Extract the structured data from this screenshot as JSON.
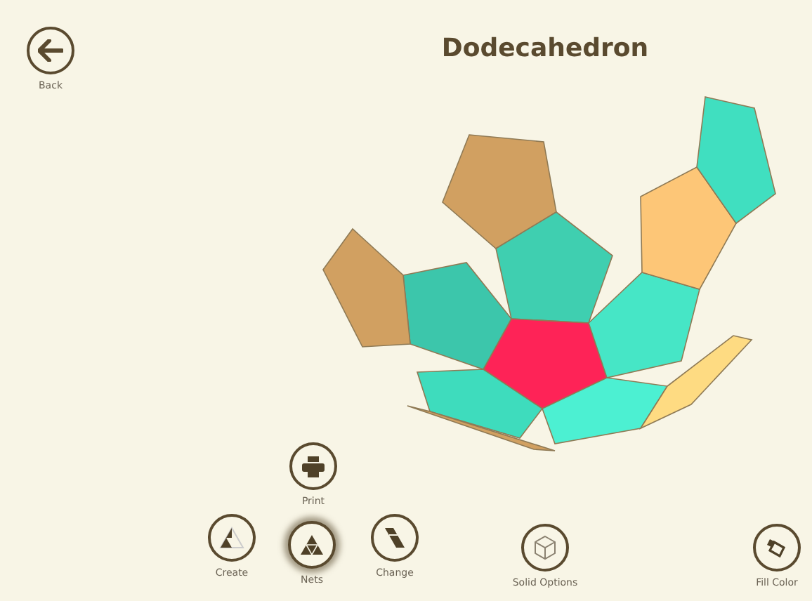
{
  "title": "Dodecahedron",
  "back": {
    "label": "Back"
  },
  "net": {
    "faces": [
      {
        "color": "#d1a061"
      },
      {
        "color": "#3fcfb0"
      },
      {
        "color": "#fe2357"
      },
      {
        "color": "#3cc6ab"
      },
      {
        "color": "#d1a061"
      },
      {
        "color": "#46e6c6"
      },
      {
        "color": "#fdc677"
      },
      {
        "color": "#40dfc0"
      },
      {
        "color": "#3edcbd"
      },
      {
        "color": "#4cf0d2"
      },
      {
        "color": "#fedb82"
      },
      {
        "color": "#d1a061"
      }
    ]
  },
  "tools": [
    {
      "kind": "print",
      "label": "Print",
      "selected": false
    },
    {
      "kind": "create",
      "label": "Create",
      "selected": false
    },
    {
      "kind": "nets",
      "label": "Nets",
      "selected": true
    },
    {
      "kind": "change",
      "label": "Change",
      "selected": false
    },
    {
      "kind": "solid",
      "label": "Solid Options",
      "selected": false
    },
    {
      "kind": "fill",
      "label": "Fill Color",
      "selected": false
    }
  ]
}
